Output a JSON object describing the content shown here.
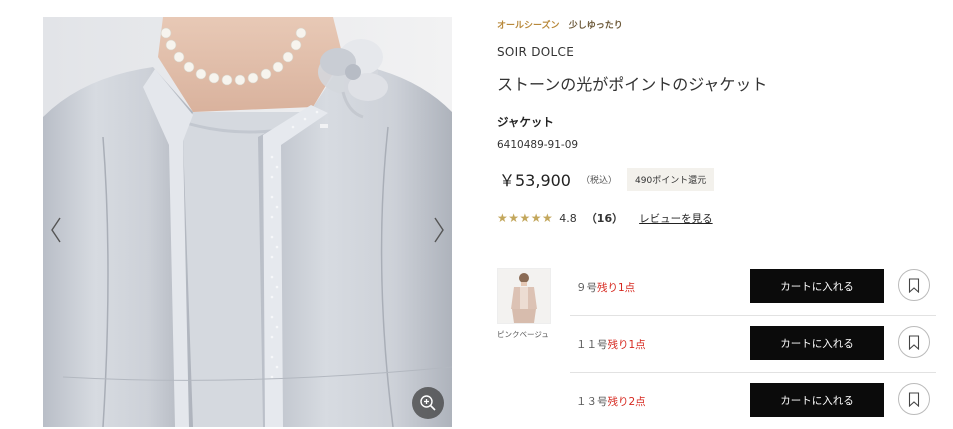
{
  "gallery": {
    "image_alt": "jacket-photo",
    "prev_icon": "chevron-left-icon",
    "next_icon": "chevron-right-icon",
    "zoom_icon": "zoom-in-icon"
  },
  "product": {
    "tags": [
      "オールシーズン",
      "少しゆったり"
    ],
    "brand": "SOIR DOLCE",
    "title": "ストーンの光がポイントのジャケット",
    "category": "ジャケット",
    "code": "6410489-91-09",
    "price": "￥53,900",
    "tax_note": "（税込）",
    "points": "490ポイント還元",
    "rating": {
      "stars": "★★★★★",
      "value": 4.8,
      "score": "4.8",
      "count": "（16）",
      "review_link": "レビューを見る"
    }
  },
  "colors": [
    {
      "name": "ピンクベージュ",
      "icon": "thumbnail-image"
    }
  ],
  "sizes": [
    {
      "size": "９号",
      "stock": "残り1点",
      "cart_label": "カートに入れる",
      "fav_icon": "bookmark-icon"
    },
    {
      "size": "１１号",
      "stock": "残り1点",
      "cart_label": "カートに入れる",
      "fav_icon": "bookmark-icon"
    },
    {
      "size": "１３号",
      "stock": "残り2点",
      "cart_label": "カートに入れる",
      "fav_icon": "bookmark-icon"
    }
  ],
  "colors_theme": {
    "accent_gold": "#b8893b",
    "stock_red": "#d6281f",
    "button_black": "#0b0b0b",
    "star_gold": "#c3a75c"
  }
}
